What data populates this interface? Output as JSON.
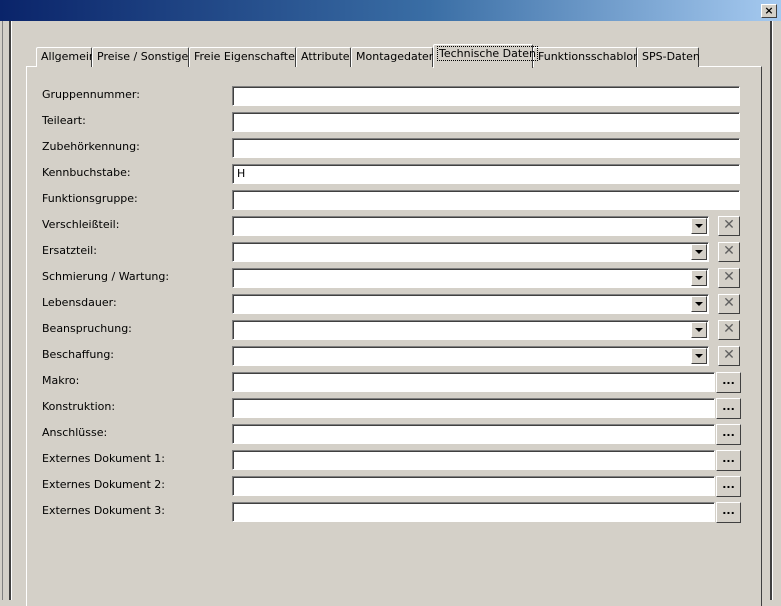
{
  "window": {
    "close_glyph": "×"
  },
  "tabs": [
    {
      "label": "Allgemein"
    },
    {
      "label": "Preise / Sonstiges"
    },
    {
      "label": "Freie Eigenschaften"
    },
    {
      "label": "Attribute"
    },
    {
      "label": "Montagedaten"
    },
    {
      "label": "Technische Daten",
      "active": true
    },
    {
      "label": "Funktionsschablone"
    },
    {
      "label": "SPS-Daten"
    }
  ],
  "form": {
    "gruppennummer": {
      "label": "Gruppennummer:",
      "value": ""
    },
    "teileart": {
      "label": "Teileart:",
      "value": ""
    },
    "zubehoerkennung": {
      "label": "Zubehörkennung:",
      "value": ""
    },
    "kennbuchstabe": {
      "label": "Kennbuchstabe:",
      "value": "H"
    },
    "funktionsgruppe": {
      "label": "Funktionsgruppe:",
      "value": ""
    },
    "verschleissteil": {
      "label": "Verschleißteil:",
      "value": ""
    },
    "ersatzteil": {
      "label": "Ersatzteil:",
      "value": ""
    },
    "schmierung": {
      "label": "Schmierung / Wartung:",
      "value": ""
    },
    "lebensdauer": {
      "label": "Lebensdauer:",
      "value": ""
    },
    "beanspruchung": {
      "label": "Beanspruchung:",
      "value": ""
    },
    "beschaffung": {
      "label": "Beschaffung:",
      "value": ""
    },
    "makro": {
      "label": "Makro:",
      "value": ""
    },
    "konstruktion": {
      "label": "Konstruktion:",
      "value": ""
    },
    "anschluesse": {
      "label": "Anschlüsse:",
      "value": ""
    },
    "extdok1": {
      "label": "Externes Dokument 1:",
      "value": ""
    },
    "extdok2": {
      "label": "Externes Dokument 2:",
      "value": ""
    },
    "extdok3": {
      "label": "Externes Dokument 3:",
      "value": ""
    }
  },
  "buttons": {
    "clear_glyph": "✕",
    "browse_label": "..."
  },
  "colors": {
    "titlebar_start": "#0a246a",
    "titlebar_end": "#a6caf0",
    "face": "#d4d0c8"
  }
}
